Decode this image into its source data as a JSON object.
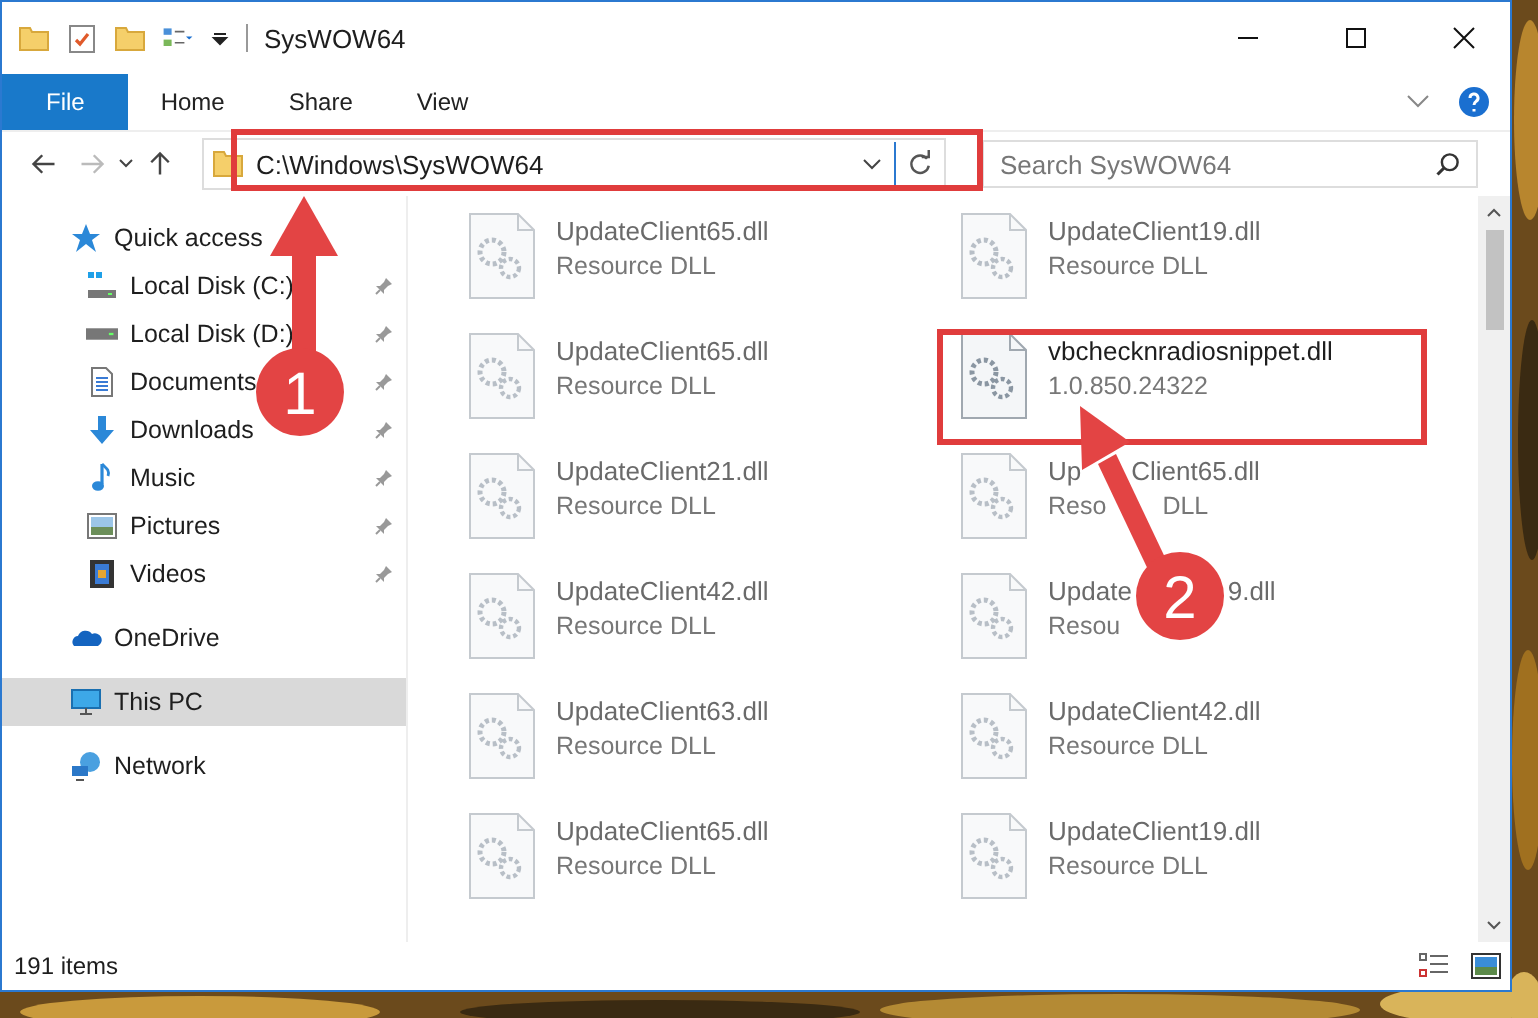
{
  "window": {
    "title": "SysWOW64"
  },
  "ribbon_tabs": [
    {
      "label": "File",
      "selected": true
    },
    {
      "label": "Home",
      "selected": false
    },
    {
      "label": "Share",
      "selected": false
    },
    {
      "label": "View",
      "selected": false
    }
  ],
  "address": {
    "path": "C:\\Windows\\SysWOW64"
  },
  "search": {
    "placeholder": "Search SysWOW64"
  },
  "sidebar": {
    "items": [
      {
        "label": "Quick access",
        "kind": "star",
        "selected": false,
        "children": [
          {
            "label": "Local Disk (C:)",
            "kind": "system-drive",
            "selected": false,
            "pinned": true
          },
          {
            "label": "Local Disk (D:)",
            "kind": "drive",
            "selected": false,
            "pinned": true
          },
          {
            "label": "Documents",
            "kind": "documents",
            "selected": false,
            "pinned": true
          },
          {
            "label": "Downloads",
            "kind": "downloads",
            "selected": false,
            "pinned": true
          },
          {
            "label": "Music",
            "kind": "music",
            "selected": false,
            "pinned": true
          },
          {
            "label": "Pictures",
            "kind": "pictures",
            "selected": false,
            "pinned": true
          },
          {
            "label": "Videos",
            "kind": "videos",
            "selected": false,
            "pinned": true
          }
        ]
      },
      {
        "label": "OneDrive",
        "kind": "cloud",
        "selected": false
      },
      {
        "label": "This PC",
        "kind": "pc",
        "selected": true
      },
      {
        "label": "Network",
        "kind": "network",
        "selected": false
      }
    ]
  },
  "files": [
    {
      "kind": "plain",
      "name_parts": [
        "UpdateClient65.dll"
      ],
      "detail_parts": [
        "Resource DLL"
      ],
      "blurred": true
    },
    {
      "kind": "plain",
      "name_parts": [
        "UpdateClient19.dll"
      ],
      "detail_parts": [
        "Resource DLL"
      ],
      "blurred": true
    },
    {
      "kind": "plain",
      "name_parts": [
        "UpdateClient65.dll"
      ],
      "detail_parts": [
        "Resource DLL"
      ],
      "blurred": true
    },
    {
      "kind": "plain",
      "name_parts": [
        "vbchecknradiosnippet.dll"
      ],
      "detail_parts": [
        "1.0.850.24322"
      ],
      "blurred": false
    },
    {
      "kind": "plain",
      "name_parts": [
        "UpdateClient21.dll"
      ],
      "detail_parts": [
        "Resource DLL"
      ],
      "blurred": true
    },
    {
      "kind": "under-arrow",
      "name_parts": [
        "Up",
        "Client65.dll"
      ],
      "detail_parts": [
        "Reso",
        "DLL"
      ],
      "blurred": true
    },
    {
      "kind": "plain",
      "name_parts": [
        "UpdateClient42.dll"
      ],
      "detail_parts": [
        "Resource DLL"
      ],
      "blurred": true
    },
    {
      "kind": "under-badge",
      "name_parts": [
        "Update",
        "9.dll"
      ],
      "detail_parts": [
        "Resou"
      ],
      "blurred": true
    },
    {
      "kind": "plain",
      "name_parts": [
        "UpdateClient63.dll"
      ],
      "detail_parts": [
        "Resource DLL"
      ],
      "blurred": true
    },
    {
      "kind": "plain",
      "name_parts": [
        "UpdateClient42.dll"
      ],
      "detail_parts": [
        "Resource DLL"
      ],
      "blurred": true
    },
    {
      "kind": "plain",
      "name_parts": [
        "UpdateClient65.dll"
      ],
      "detail_parts": [
        "Resource DLL"
      ],
      "blurred": true
    },
    {
      "kind": "plain",
      "name_parts": [
        "UpdateClient19.dll"
      ],
      "detail_parts": [
        "Resource DLL"
      ],
      "blurred": true
    }
  ],
  "status_bar": {
    "count": "191 items"
  },
  "annotations": [
    {
      "number": "1"
    },
    {
      "number": "2"
    }
  ]
}
